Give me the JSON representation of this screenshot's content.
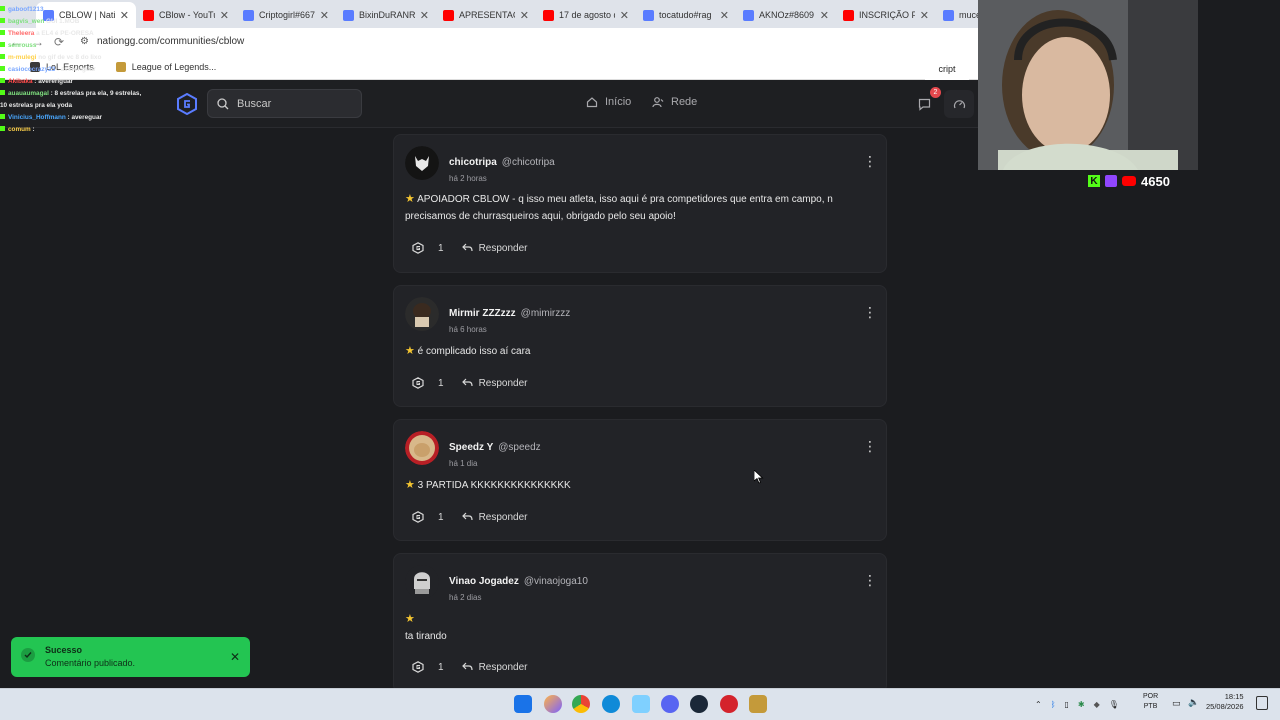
{
  "browser": {
    "tabs": [
      {
        "label": "CBLOW | Natio",
        "active": true,
        "fav_color": "#5a7cff"
      },
      {
        "label": "CBlow - YouTu",
        "active": false,
        "fav_color": "#ff0000"
      },
      {
        "label": "Criptogirl#667",
        "active": false,
        "fav_color": "#5a7cff"
      },
      {
        "label": "BixinDuRANRA",
        "active": false,
        "fav_color": "#5a7cff"
      },
      {
        "label": "APRESENTACIO",
        "active": false,
        "fav_color": "#ff0000"
      },
      {
        "label": "17 de agosto d",
        "active": false,
        "fav_color": "#ff0000"
      },
      {
        "label": "tocatudo#rag",
        "active": false,
        "fav_color": "#5a7cff"
      },
      {
        "label": "AKNOz#8609",
        "active": false,
        "fav_color": "#5a7cff"
      },
      {
        "label": "INSCRIÇÃO PA",
        "active": false,
        "fav_color": "#ff0000"
      },
      {
        "label": "mucego",
        "active": false,
        "fav_color": "#5a7cff"
      }
    ],
    "url": "nationgg.com/communities/cblow",
    "bookmarks": [
      "LoL Esports",
      "League of Legends..."
    ],
    "side_label": "cript"
  },
  "header": {
    "search_placeholder": "Buscar",
    "nav": {
      "home": "Início",
      "network": "Rede"
    },
    "notification_count": "2"
  },
  "posts": [
    {
      "name": "chicotripa",
      "handle": "@chicotripa",
      "time": "há 2 horas",
      "lines": [
        "APOIADOR CBLOW - q isso meu atleta, isso aqui é pra competidores que entra em campo, n",
        "precisamos de churrasqueiros aqui, obrigado pelo seu apoio!"
      ],
      "likes": "1",
      "reply": "Responder"
    },
    {
      "name": "Mirmir ZZZzzz",
      "handle": "@mimirzzz",
      "time": "há 6 horas",
      "lines": [
        "é complicado isso  aí cara"
      ],
      "likes": "1",
      "reply": "Responder"
    },
    {
      "name": "Speedz Y",
      "handle": "@speedz",
      "time": "há 1 dia",
      "lines": [
        "3 PARTIDA KKKKKKKKKKKKKKK"
      ],
      "likes": "1",
      "reply": "Responder"
    },
    {
      "name": "Vinao Jogadez",
      "handle": "@vinaojoga10",
      "time": "há 2 dias",
      "lines": [
        "",
        "ta tirando"
      ],
      "likes": "1",
      "reply": "Responder"
    }
  ],
  "toast": {
    "title": "Sucesso",
    "message": "Comentário publicado."
  },
  "chat": [
    {
      "user": "gaboof1213",
      "msg": "",
      "color": "#7aa7ff"
    },
    {
      "user": "bagvis_wen",
      "msg": "GUI 1.MOB",
      "color": "#7fe07f"
    },
    {
      "user": "Theleera",
      "msg": "a EL4 é PE-ORESA",
      "color": "#ff6b6b"
    },
    {
      "user": "senrouss",
      "msg": "",
      "color": "#7fe07f"
    },
    {
      "user": "m-mulegi",
      "msg": "no gif de vc 8 do lixo",
      "color": "#ffd24a"
    },
    {
      "user": "casiococrazy23",
      "msg": ": avereriguar",
      "color": "#7aa7ff"
    },
    {
      "user": "Akibaka",
      "msg": ": avereriguar",
      "color": "#ff4a4a"
    },
    {
      "user": "auauaumagal",
      "msg": ": 8 estrelas pra ela, 9 estrelas,",
      "color": "#7fe07f"
    },
    {
      "user": "",
      "msg": "10 estrelas pra ela yoda",
      "color": "#e8e8e8"
    },
    {
      "user": "Vinicius_Hoffmann",
      "msg": ": avereguar",
      "color": "#4aa8ff"
    },
    {
      "user": "comum",
      "msg": ":",
      "color": "#ffd24a"
    }
  ],
  "stream": {
    "viewer_count": "4650"
  },
  "taskbar": {
    "lang_top": "POR",
    "lang_bottom": "PTB",
    "time": "18:15",
    "date": "25/08/2026"
  },
  "colors": {
    "accent": "#5a7cff",
    "toast": "#23c552",
    "card": "#222327",
    "bg": "#1b1c1f"
  }
}
